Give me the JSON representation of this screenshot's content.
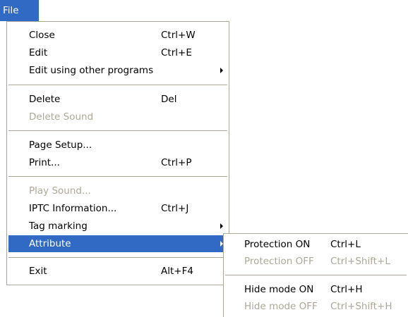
{
  "menubar": {
    "file_label": "File"
  },
  "file_menu": {
    "close": {
      "label": "Close",
      "shortcut": "Ctrl+W"
    },
    "edit": {
      "label": "Edit",
      "shortcut": "Ctrl+E"
    },
    "edit_other": {
      "label": "Edit using other programs"
    },
    "delete": {
      "label": "Delete",
      "shortcut": "Del"
    },
    "delete_sound": {
      "label": "Delete Sound"
    },
    "page_setup": {
      "label": "Page Setup..."
    },
    "print": {
      "label": "Print...",
      "shortcut": "Ctrl+P"
    },
    "play_sound": {
      "label": "Play Sound..."
    },
    "iptc": {
      "label": "IPTC Information...",
      "shortcut": "Ctrl+J"
    },
    "tag_marking": {
      "label": "Tag marking"
    },
    "attribute": {
      "label": "Attribute"
    },
    "exit": {
      "label": "Exit",
      "shortcut": "Alt+F4"
    }
  },
  "attribute_menu": {
    "protection_on": {
      "label": "Protection ON",
      "shortcut": "Ctrl+L"
    },
    "protection_off": {
      "label": "Protection OFF",
      "shortcut": "Ctrl+Shift+L"
    },
    "hide_on": {
      "label": "Hide mode ON",
      "shortcut": "Ctrl+H"
    },
    "hide_off": {
      "label": "Hide mode OFF",
      "shortcut": "Ctrl+Shift+H"
    }
  },
  "colors": {
    "highlight": "#316ac5",
    "disabled_text": "#aca899",
    "border": "#aca899"
  }
}
